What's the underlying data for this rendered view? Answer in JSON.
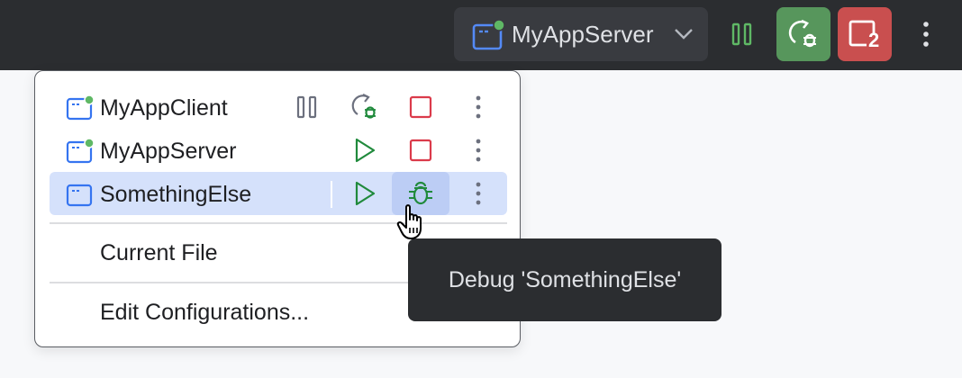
{
  "toolbar": {
    "run_config_name": "MyAppServer",
    "icons": {
      "config": "run-config-icon",
      "dropdown": "chevron-down-icon",
      "pause": "pause-icon",
      "rerun_debug": "rerun-debug-icon",
      "stop_all": "stop-all-icon",
      "more": "more-vertical-icon"
    },
    "stop_all_count": "2"
  },
  "popup": {
    "configurations": [
      {
        "label": "MyAppClient",
        "running": true,
        "actions": [
          "pause-icon",
          "rerun-debug-icon",
          "stop-icon",
          "more-vertical-icon"
        ]
      },
      {
        "label": "MyAppServer",
        "running": true,
        "actions": [
          "run-icon",
          "stop-icon",
          "more-vertical-icon"
        ]
      },
      {
        "label": "SomethingElse",
        "running": false,
        "selected": true,
        "actions": [
          "run-icon",
          "debug-icon",
          "more-vertical-icon"
        ]
      }
    ],
    "current_file_label": "Current File",
    "edit_configurations_label": "Edit Configurations..."
  },
  "tooltip": {
    "text": "Debug 'SomethingElse'"
  },
  "colors": {
    "toolbar_bg": "#2b2d30",
    "widget_bg": "#393b40",
    "run_green": "#57965c",
    "stop_red": "#c94f4f",
    "selection_blue": "#d5e1fb",
    "config_blue": "#3574f0"
  }
}
